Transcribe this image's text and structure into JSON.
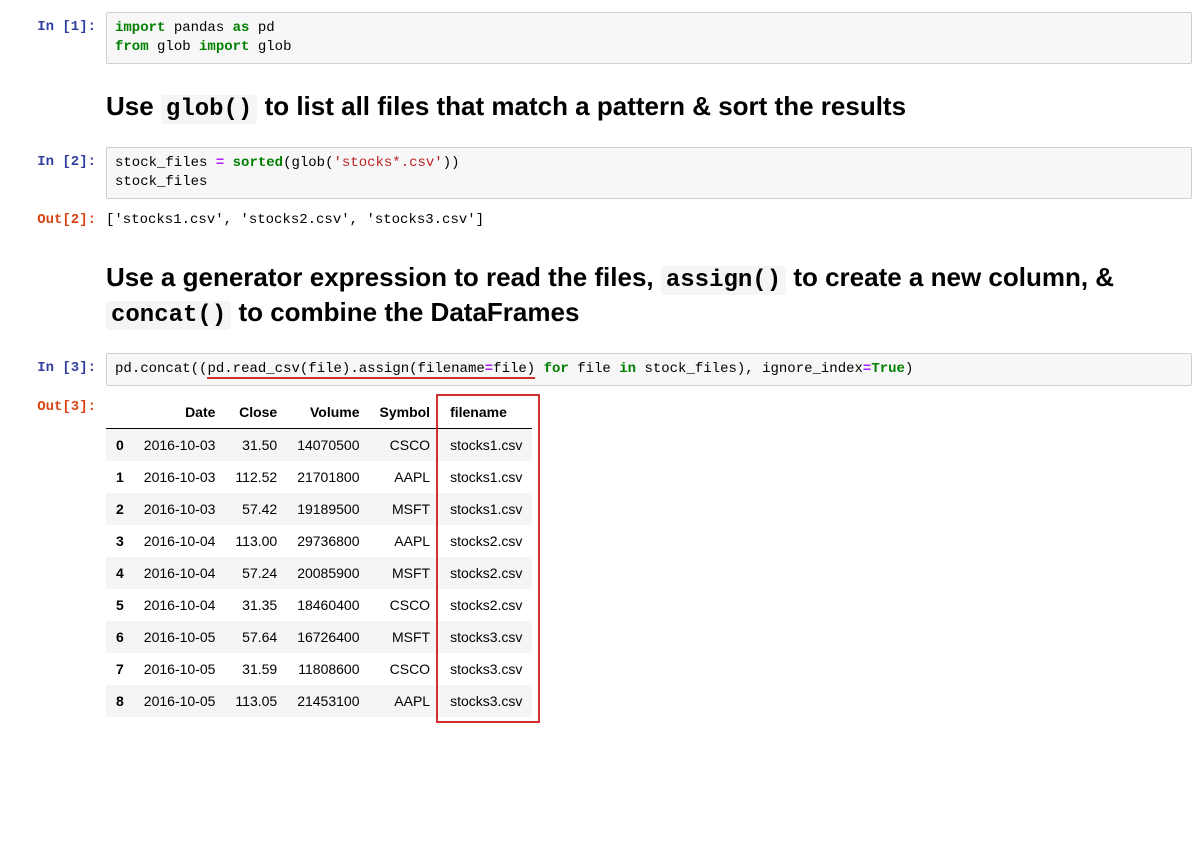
{
  "cell1": {
    "prompt": "In [1]:",
    "code_tokens": [
      {
        "t": "import",
        "c": "kw"
      },
      {
        "t": " "
      },
      {
        "t": "pandas",
        "c": "name"
      },
      {
        "t": " "
      },
      {
        "t": "as",
        "c": "kw"
      },
      {
        "t": " "
      },
      {
        "t": "pd",
        "c": "name"
      },
      {
        "t": "\n"
      },
      {
        "t": "from",
        "c": "kw"
      },
      {
        "t": " "
      },
      {
        "t": "glob",
        "c": "name"
      },
      {
        "t": " "
      },
      {
        "t": "import",
        "c": "kw"
      },
      {
        "t": " "
      },
      {
        "t": "glob",
        "c": "name"
      }
    ]
  },
  "md1": {
    "parts": [
      {
        "t": "Use "
      },
      {
        "t": "glob()",
        "code": true
      },
      {
        "t": " to list all files that match a pattern & sort the results"
      }
    ]
  },
  "cell2": {
    "prompt": "In [2]:",
    "code_tokens": [
      {
        "t": "stock_files",
        "c": "name"
      },
      {
        "t": " "
      },
      {
        "t": "=",
        "c": "op"
      },
      {
        "t": " "
      },
      {
        "t": "sorted",
        "c": "kw"
      },
      {
        "t": "("
      },
      {
        "t": "glob",
        "c": "name"
      },
      {
        "t": "("
      },
      {
        "t": "'stocks*.csv'",
        "c": "str"
      },
      {
        "t": "))"
      },
      {
        "t": "\n"
      },
      {
        "t": "stock_files",
        "c": "name"
      }
    ]
  },
  "out2": {
    "prompt": "Out[2]:",
    "text": "['stocks1.csv', 'stocks2.csv', 'stocks3.csv']"
  },
  "md2": {
    "parts": [
      {
        "t": "Use a generator expression to read the files, "
      },
      {
        "t": "assign()",
        "code": true
      },
      {
        "t": " to create a new column, & "
      },
      {
        "t": "concat()",
        "code": true
      },
      {
        "t": " to combine the DataFrames"
      }
    ]
  },
  "cell3": {
    "prompt": "In [3]:",
    "code_tokens": [
      {
        "t": "pd",
        "c": "name"
      },
      {
        "t": "."
      },
      {
        "t": "concat",
        "c": "name"
      },
      {
        "t": "(("
      },
      {
        "t": "pd",
        "c": "name",
        "u": true
      },
      {
        "t": ".",
        "u": true
      },
      {
        "t": "read_csv",
        "c": "name",
        "u": true
      },
      {
        "t": "(",
        "u": true
      },
      {
        "t": "file",
        "c": "name",
        "u": true
      },
      {
        "t": ")",
        "u": true
      },
      {
        "t": ".",
        "u": true
      },
      {
        "t": "assign",
        "c": "name",
        "u": true
      },
      {
        "t": "(",
        "u": true
      },
      {
        "t": "filename",
        "c": "name",
        "u": true
      },
      {
        "t": "=",
        "c": "op",
        "u": true
      },
      {
        "t": "file",
        "c": "name",
        "u": true
      },
      {
        "t": ")",
        "u": true
      },
      {
        "t": " "
      },
      {
        "t": "for",
        "c": "kw"
      },
      {
        "t": " "
      },
      {
        "t": "file",
        "c": "name"
      },
      {
        "t": " "
      },
      {
        "t": "in",
        "c": "kw"
      },
      {
        "t": " "
      },
      {
        "t": "stock_files",
        "c": "name"
      },
      {
        "t": "), "
      },
      {
        "t": "ignore_index",
        "c": "name"
      },
      {
        "t": "=",
        "c": "op"
      },
      {
        "t": "True",
        "c": "kw"
      },
      {
        "t": ")"
      }
    ]
  },
  "out3": {
    "prompt": "Out[3]:",
    "columns": [
      "Date",
      "Close",
      "Volume",
      "Symbol",
      "filename"
    ],
    "rows": [
      {
        "idx": "0",
        "Date": "2016-10-03",
        "Close": "31.50",
        "Volume": "14070500",
        "Symbol": "CSCO",
        "filename": "stocks1.csv"
      },
      {
        "idx": "1",
        "Date": "2016-10-03",
        "Close": "112.52",
        "Volume": "21701800",
        "Symbol": "AAPL",
        "filename": "stocks1.csv"
      },
      {
        "idx": "2",
        "Date": "2016-10-03",
        "Close": "57.42",
        "Volume": "19189500",
        "Symbol": "MSFT",
        "filename": "stocks1.csv"
      },
      {
        "idx": "3",
        "Date": "2016-10-04",
        "Close": "113.00",
        "Volume": "29736800",
        "Symbol": "AAPL",
        "filename": "stocks2.csv"
      },
      {
        "idx": "4",
        "Date": "2016-10-04",
        "Close": "57.24",
        "Volume": "20085900",
        "Symbol": "MSFT",
        "filename": "stocks2.csv"
      },
      {
        "idx": "5",
        "Date": "2016-10-04",
        "Close": "31.35",
        "Volume": "18460400",
        "Symbol": "CSCO",
        "filename": "stocks2.csv"
      },
      {
        "idx": "6",
        "Date": "2016-10-05",
        "Close": "57.64",
        "Volume": "16726400",
        "Symbol": "MSFT",
        "filename": "stocks3.csv"
      },
      {
        "idx": "7",
        "Date": "2016-10-05",
        "Close": "31.59",
        "Volume": "11808600",
        "Symbol": "CSCO",
        "filename": "stocks3.csv"
      },
      {
        "idx": "8",
        "Date": "2016-10-05",
        "Close": "113.05",
        "Volume": "21453100",
        "Symbol": "AAPL",
        "filename": "stocks3.csv"
      }
    ]
  }
}
